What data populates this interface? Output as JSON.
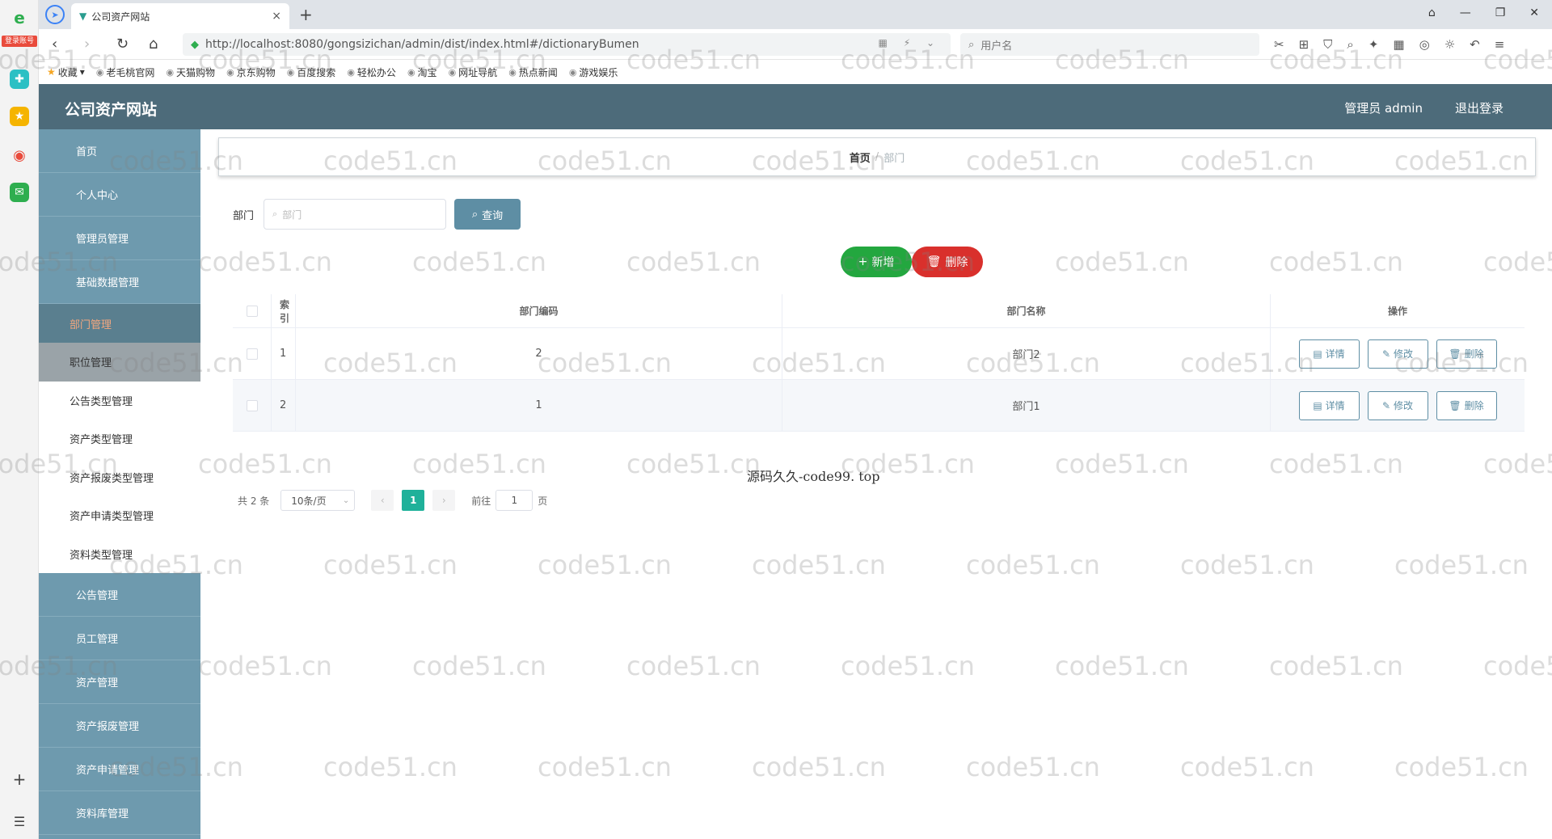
{
  "browser": {
    "rail_badge": "登录账号",
    "tab_title": "公司资产网站",
    "tab_close": "×",
    "new_tab": "+",
    "url": "http://localhost:8080/gongsizichan/admin/dist/index.html#/dictionaryBumen",
    "search_placeholder": "用户名",
    "bookmarks": [
      "收藏",
      "老毛桃官网",
      "天猫购物",
      "京东购物",
      "百度搜索",
      "轻松办公",
      "淘宝",
      "网址导航",
      "热点新闻",
      "游戏娱乐"
    ]
  },
  "app": {
    "title": "公司资产网站",
    "user": "管理员 admin",
    "logout": "退出登录"
  },
  "sidebar": {
    "items_top": [
      "首页",
      "个人中心",
      "管理员管理",
      "基础数据管理"
    ],
    "submenu_head": "部门管理",
    "sub_items": [
      "职位管理",
      "公告类型管理",
      "资产类型管理",
      "资产报废类型管理",
      "资产申请类型管理",
      "资料类型管理"
    ],
    "items_bottom": [
      "公告管理",
      "员工管理",
      "资产管理",
      "资产报废管理",
      "资产申请管理",
      "资料库管理"
    ]
  },
  "breadcrumb": {
    "home": "首页",
    "sep": "/",
    "current": "部门"
  },
  "filter": {
    "label": "部门",
    "placeholder": "部门",
    "query_button": "查询"
  },
  "actions": {
    "add": "新增",
    "delete": "删除"
  },
  "table": {
    "headers": {
      "index": "索引",
      "code": "部门编码",
      "name": "部门名称",
      "op": "操作"
    },
    "rows": [
      {
        "index": "1",
        "code": "2",
        "name": "部门2"
      },
      {
        "index": "2",
        "code": "1",
        "name": "部门1"
      }
    ],
    "ops": {
      "detail": "详情",
      "edit": "修改",
      "delete": "删除"
    }
  },
  "pagination": {
    "total": "共 2 条",
    "page_size": "10条/页",
    "current_page": "1",
    "goto_prefix": "前往",
    "goto_value": "1",
    "goto_suffix": "页"
  },
  "overlay_text": "源码久久-code99. top",
  "watermark": "code51.cn",
  "colors": {
    "header": "#4d6b7a",
    "sidebar": "#6e9aae",
    "accent": "#5e8ea4",
    "add": "#23a73f",
    "delete": "#d9302c",
    "page_active": "#1fb19a"
  }
}
